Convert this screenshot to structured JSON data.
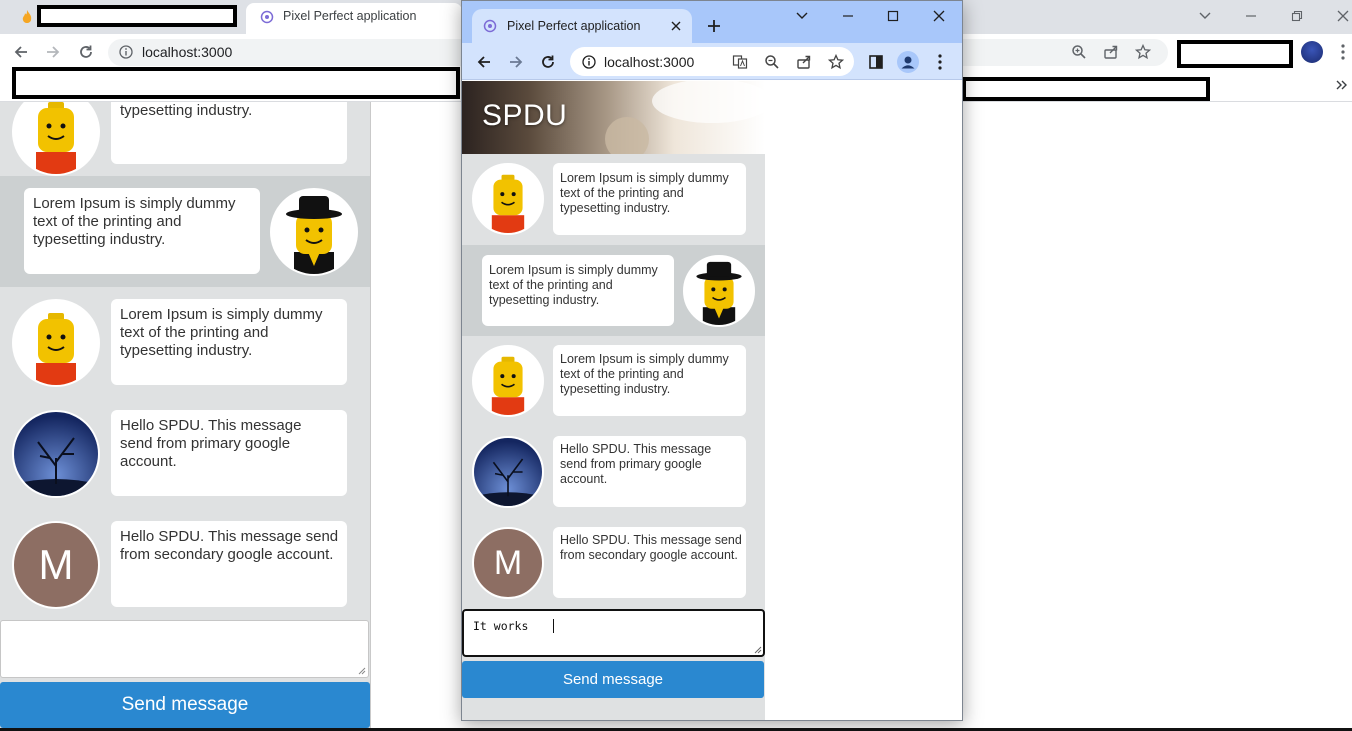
{
  "browser_bg": {
    "tab_title": "Pixel Perfect application",
    "url": "localhost:3000"
  },
  "browser_front": {
    "tab_title": "Pixel Perfect application",
    "url": "localhost:3000"
  },
  "app": {
    "title": "SPDU",
    "messages": [
      {
        "text": "Lorem Ipsum is simply dummy text of the printing and typesetting industry.",
        "avatar": "lego-yellow-icon",
        "side": "left"
      },
      {
        "text": "Lorem Ipsum is simply dummy text of the printing and typesetting industry.",
        "avatar": "lego-hat-icon",
        "side": "right"
      },
      {
        "text": "Lorem Ipsum is simply dummy text of the printing and typesetting industry.",
        "avatar": "lego-yellow-icon",
        "side": "left"
      },
      {
        "text": "Hello SPDU. This message send from primary google account.",
        "avatar": "night-tree-icon",
        "side": "left"
      },
      {
        "text": "Hello SPDU. This message send from secondary google account.",
        "avatar": "letter-m-avatar",
        "side": "left",
        "initial": "M"
      }
    ],
    "bg_partial_message": "text of the printing and typesetting industry.",
    "input_value": "It works",
    "send_label": "Send message"
  },
  "colors": {
    "send_button": "#2a88d0",
    "chat_bg": "#dfe1e2",
    "alt_row_bg": "#ccd0d1",
    "avatar_m": "#8d6e63"
  }
}
